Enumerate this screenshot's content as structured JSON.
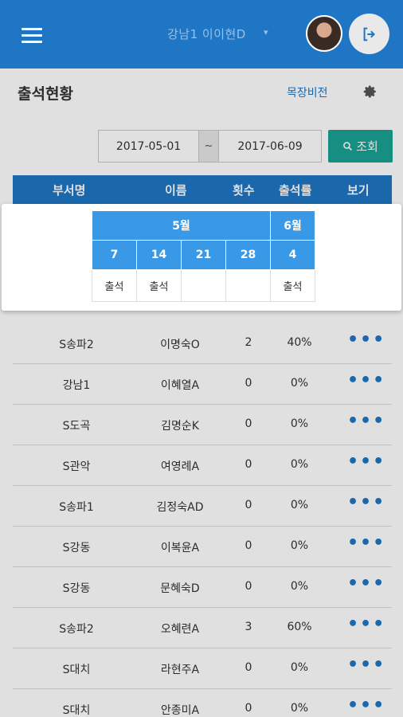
{
  "header": {
    "username": "강남1 이이현D",
    "menu_icon": "hamburger-icon",
    "caret_icon": "chevron-down-icon",
    "logout_icon": "logout-icon"
  },
  "page": {
    "title": "출석현황",
    "vision_link": "목장비전",
    "settings_icon": "gear-icon"
  },
  "filter": {
    "start_date": "2017-05-01",
    "separator": "~",
    "end_date": "2017-06-09",
    "search_label": "조회",
    "search_icon": "search-icon"
  },
  "table": {
    "headers": [
      "부서명",
      "이름",
      "횟수",
      "출석률",
      "보기"
    ],
    "view_icon": "more-dots-icon",
    "rows": [
      {
        "dept": "S송파2",
        "name": "이명숙O",
        "count": "2",
        "rate": "40%"
      },
      {
        "dept": "강남1",
        "name": "이혜열A",
        "count": "0",
        "rate": "0%"
      },
      {
        "dept": "S도곡",
        "name": "김명순K",
        "count": "0",
        "rate": "0%"
      },
      {
        "dept": "S관악",
        "name": "여영례A",
        "count": "0",
        "rate": "0%"
      },
      {
        "dept": "S송파1",
        "name": "김정숙AD",
        "count": "0",
        "rate": "0%"
      },
      {
        "dept": "S강동",
        "name": "이복윤A",
        "count": "0",
        "rate": "0%"
      },
      {
        "dept": "S강동",
        "name": "문혜숙D",
        "count": "0",
        "rate": "0%"
      },
      {
        "dept": "S송파2",
        "name": "오혜련A",
        "count": "3",
        "rate": "60%"
      },
      {
        "dept": "S대치",
        "name": "라현주A",
        "count": "0",
        "rate": "0%"
      },
      {
        "dept": "S대치",
        "name": "안종미A",
        "count": "0",
        "rate": "0%"
      }
    ]
  },
  "popup": {
    "months": [
      "5월",
      "6월"
    ],
    "days": [
      "7",
      "14",
      "21",
      "28",
      "4"
    ],
    "attendance": [
      "출석",
      "출석",
      "",
      "",
      "출석"
    ]
  },
  "colors": {
    "primary": "#1f76c4",
    "accent": "#1aa395",
    "calendar": "#3a99e6"
  }
}
